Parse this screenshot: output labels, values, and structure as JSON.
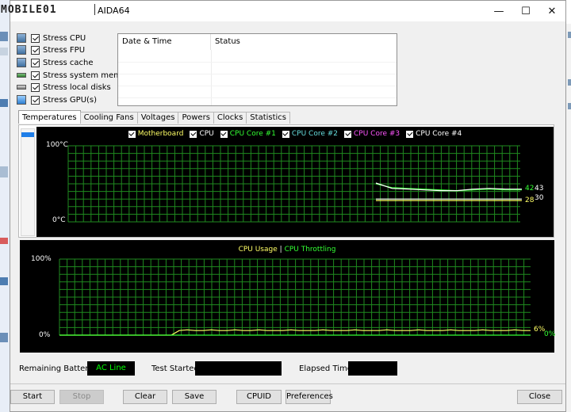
{
  "window": {
    "logo_text": "MOBILE01",
    "title": "AIDA64",
    "controls": {
      "minimize": "—",
      "maximize": "☐",
      "close": "✕"
    }
  },
  "stress": [
    {
      "label": "Stress CPU",
      "checked": true,
      "icon": "cpu-icon"
    },
    {
      "label": "Stress FPU",
      "checked": true,
      "icon": "fpu-icon"
    },
    {
      "label": "Stress cache",
      "checked": true,
      "icon": "cache-icon"
    },
    {
      "label": "Stress system memory",
      "checked": true,
      "icon": "memory-icon"
    },
    {
      "label": "Stress local disks",
      "checked": true,
      "icon": "disk-icon"
    },
    {
      "label": "Stress GPU(s)",
      "checked": true,
      "icon": "gpu-icon"
    }
  ],
  "log_table": {
    "columns": [
      "Date & Time",
      "Status"
    ],
    "rows": []
  },
  "tabs": [
    "Temperatures",
    "Cooling Fans",
    "Voltages",
    "Powers",
    "Clocks",
    "Statistics"
  ],
  "active_tab": "Temperatures",
  "temperature_chart": {
    "legend": [
      {
        "label": "Motherboard",
        "color": "#ffff66",
        "checked": true
      },
      {
        "label": "CPU",
        "color": "#ffffff",
        "checked": true
      },
      {
        "label": "CPU Core #1",
        "color": "#33ff33",
        "checked": true
      },
      {
        "label": "CPU Core #2",
        "color": "#66dddd",
        "checked": true
      },
      {
        "label": "CPU Core #3",
        "color": "#ff55ff",
        "checked": true
      },
      {
        "label": "CPU Core #4",
        "color": "#ffffff",
        "checked": true
      }
    ],
    "y_top_label": "100°C",
    "y_bottom_label": "0°C",
    "end_labels": [
      {
        "text": "42",
        "color": "#33ff33"
      },
      {
        "text": "43",
        "color": "#ffffff"
      },
      {
        "text": "30",
        "color": "#ffffff"
      },
      {
        "text": "28",
        "color": "#ffff66"
      }
    ]
  },
  "cpu_chart": {
    "legend_usage": "CPU Usage",
    "legend_sep": "|",
    "legend_throttling": "CPU Throttling",
    "usage_color": "#ffff66",
    "throttling_color": "#33ff33",
    "y_top_label": "100%",
    "y_bottom_label": "0%",
    "end_usage": "6%",
    "end_throttling": "0%"
  },
  "chart_data": [
    {
      "type": "line",
      "title": "",
      "ylim": [
        0,
        100
      ],
      "yunit": "°C",
      "series": [
        {
          "name": "Motherboard",
          "values": [
            28,
            28,
            28,
            28,
            28,
            28,
            28,
            28,
            28,
            28
          ]
        },
        {
          "name": "CPU",
          "values": [
            30,
            30,
            30,
            30,
            30,
            30,
            30,
            30,
            30,
            30
          ]
        },
        {
          "name": "CPU Core #1",
          "values": [
            50,
            45,
            44,
            43,
            42,
            41,
            42,
            43,
            42,
            42
          ]
        },
        {
          "name": "CPU Core #4",
          "values": [
            51,
            44,
            43,
            42,
            41,
            41,
            43,
            44,
            43,
            43
          ]
        }
      ]
    },
    {
      "type": "line",
      "title": "",
      "ylim": [
        0,
        100
      ],
      "yunit": "%",
      "series": [
        {
          "name": "CPU Usage",
          "values": [
            0,
            0,
            0,
            0,
            0,
            0,
            0,
            0,
            0,
            0,
            0,
            0,
            0,
            0,
            0,
            6,
            7,
            6,
            6,
            7,
            6,
            6,
            7,
            6,
            6,
            7,
            6,
            6,
            6,
            7,
            6,
            6,
            6,
            7,
            6,
            6,
            6,
            7,
            6,
            6,
            6,
            7,
            6,
            6,
            6,
            7,
            6,
            6,
            6,
            7,
            6,
            6,
            6,
            7,
            6,
            6,
            6,
            7,
            6,
            6
          ]
        },
        {
          "name": "CPU Throttling",
          "values": [
            0,
            0,
            0,
            0,
            0,
            0,
            0,
            0,
            0,
            0,
            0,
            0,
            0,
            0,
            0,
            0,
            0,
            0,
            0,
            0,
            0,
            0,
            0,
            0,
            0,
            0,
            0,
            0,
            0,
            0,
            0,
            0,
            0,
            0,
            0,
            0,
            0,
            0,
            0,
            0,
            0,
            0,
            0,
            0,
            0,
            0,
            0,
            0,
            0,
            0,
            0,
            0,
            0,
            0,
            0,
            0,
            0,
            0,
            0,
            0
          ]
        }
      ]
    }
  ],
  "status": {
    "battery_label": "Remaining Battery:",
    "battery_value": "AC Line",
    "test_started_label": "Test Started:",
    "test_started_value": "",
    "elapsed_label": "Elapsed Time:",
    "elapsed_value": ""
  },
  "buttons": {
    "start": "Start",
    "stop": "Stop",
    "clear": "Clear",
    "save": "Save",
    "cpuid": "CPUID",
    "preferences": "Preferences",
    "close": "Close"
  }
}
